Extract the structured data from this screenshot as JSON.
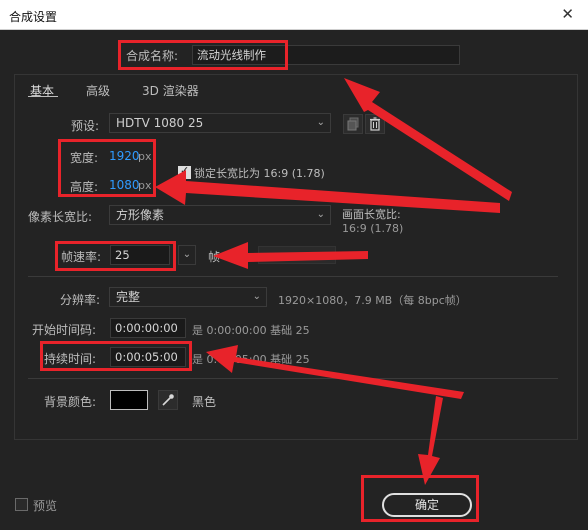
{
  "window": {
    "title": "合成设置",
    "close_glyph": "✕"
  },
  "name_row": {
    "label": "合成名称:",
    "value": "流动光线制作"
  },
  "tabs": [
    {
      "label": "基本"
    },
    {
      "label": "高级"
    },
    {
      "label": "3D 渲染器"
    }
  ],
  "preset": {
    "label": "预设:",
    "value": "HDTV 1080 25"
  },
  "width": {
    "label": "宽度:",
    "value": "1920",
    "unit": "px"
  },
  "height": {
    "label": "高度:",
    "value": "1080",
    "unit": "px"
  },
  "lock_aspect": {
    "label": "锁定长宽比为 16:9 (1.78)",
    "checked": true
  },
  "pixel_aspect": {
    "label": "像素长宽比:",
    "value": "方形像素",
    "frame_aspect_label": "画面长宽比:",
    "frame_aspect_value": "16:9 (1.78)"
  },
  "frame_rate": {
    "label": "帧速率:",
    "value": "25",
    "unit_label": "帧"
  },
  "resolution": {
    "label": "分辨率:",
    "value": "完整",
    "info": "1920×1080，7.9 MB（每 8bpc帧）"
  },
  "start_timecode": {
    "label": "开始时间码:",
    "value": "0:00:00:00",
    "info": "是 0:00:00:00  基础 25"
  },
  "duration": {
    "label": "持续时间:",
    "value": "0:00:05:00",
    "info": "是 0:00:05:00  基础 25"
  },
  "background": {
    "label": "背景颜色:",
    "color": "#000000",
    "color_name": "黑色"
  },
  "footer": {
    "preview_label": "预览",
    "ok_label": "确定"
  },
  "colors": {
    "annotation_red": "#e8232a",
    "value_blue": "#2f9bff",
    "dialog_bg": "#232323"
  }
}
